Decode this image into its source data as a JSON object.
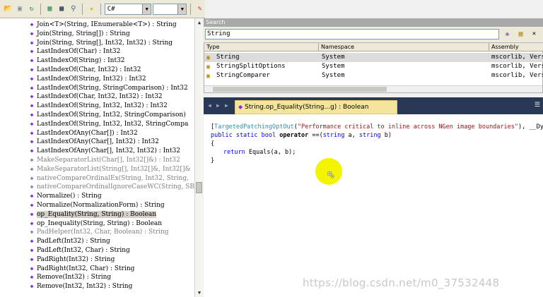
{
  "toolbar": {
    "language_value": "C#",
    "version_value": "",
    "icons": [
      "open-folder-icon",
      "save-icon",
      "refresh-icon",
      "classes-view-icon",
      "console-icon",
      "search-icon",
      "favorite-star-icon",
      "edit-icon"
    ]
  },
  "tree": {
    "items": [
      {
        "label": "Join<T>(String, IEnumerable<T>) : String",
        "gray": false
      },
      {
        "label": "Join(String, String[]) : String",
        "gray": false
      },
      {
        "label": "Join(String, String[], Int32, Int32) : String",
        "gray": false
      },
      {
        "label": "LastIndexOf(Char) : Int32",
        "gray": false
      },
      {
        "label": "LastIndexOf(String) : Int32",
        "gray": false
      },
      {
        "label": "LastIndexOf(Char, Int32) : Int32",
        "gray": false
      },
      {
        "label": "LastIndexOf(String, Int32) : Int32",
        "gray": false
      },
      {
        "label": "LastIndexOf(String, StringComparison) : Int32",
        "gray": false
      },
      {
        "label": "LastIndexOf(Char, Int32, Int32) : Int32",
        "gray": false
      },
      {
        "label": "LastIndexOf(String, Int32, Int32) : Int32",
        "gray": false
      },
      {
        "label": "LastIndexOf(String, Int32, StringComparison)",
        "gray": false
      },
      {
        "label": "LastIndexOf(String, Int32, Int32, StringCompa",
        "gray": false
      },
      {
        "label": "LastIndexOfAny(Char[]) : Int32",
        "gray": false
      },
      {
        "label": "LastIndexOfAny(Char[], Int32) : Int32",
        "gray": false
      },
      {
        "label": "LastIndexOfAny(Char[], Int32, Int32) : Int32",
        "gray": false
      },
      {
        "label": "MakeSeparatorList(Char[], Int32[]&) : Int32",
        "gray": true
      },
      {
        "label": "MakeSeparatorList(String[], Int32[]&, Int32[]&",
        "gray": true
      },
      {
        "label": "nativeCompareOrdinalEx(String, Int32, String,",
        "gray": true
      },
      {
        "label": "nativeCompareOrdinalIgnoreCaseWC(String, SByt",
        "gray": true
      },
      {
        "label": "Normalize() : String",
        "gray": false
      },
      {
        "label": "Normalize(NormalizationForm) : String",
        "gray": false
      },
      {
        "label": "op_Equality(String, String) : Boolean",
        "gray": false,
        "selected": true
      },
      {
        "label": "op_Inequality(String, String) : Boolean",
        "gray": false
      },
      {
        "label": "PadHelper(Int32, Char, Boolean) : String",
        "gray": true
      },
      {
        "label": "PadLeft(Int32) : String",
        "gray": false
      },
      {
        "label": "PadLeft(Int32, Char) : String",
        "gray": false
      },
      {
        "label": "PadRight(Int32) : String",
        "gray": false
      },
      {
        "label": "PadRight(Int32, Char) : String",
        "gray": false
      },
      {
        "label": "Remove(Int32) : String",
        "gray": false
      },
      {
        "label": "Remove(Int32, Int32) : String",
        "gray": false
      }
    ]
  },
  "search": {
    "header": "Search",
    "query": "String",
    "columns": [
      "Type",
      "Namespace",
      "Assembly"
    ],
    "results": [
      {
        "type": "String",
        "namespace": "System",
        "assembly": "mscorlib, Versi",
        "selected": true
      },
      {
        "type": "StringSplitOptions",
        "namespace": "System",
        "assembly": "mscorlib, Versi"
      },
      {
        "type": "StringComparer",
        "namespace": "System",
        "assembly": "mscorlib, Versi"
      }
    ]
  },
  "editor": {
    "tab_title": "String.op_Equality(String...g) : Boolean",
    "code": {
      "line1_bracket_open": "[",
      "line1_attr": "TargetedPatchingOptOut",
      "line1_paren": "(",
      "line1_string": "\"Performance critical to inline across NGen image boundaries\"",
      "line1_rest": "), __Dynamica",
      "line2_kw": "public static bool",
      "line2_op": "operator",
      "line2_rest": "==(",
      "line2_kw2": "string",
      "line2_a": " a, ",
      "line2_kw3": "string",
      "line2_b": " b)",
      "line3": "{",
      "line4_kw": "return",
      "line4_rest": " Equals(a, b);",
      "line5": "}"
    }
  },
  "watermark": "https://blog.csdn.net/m0_37532448"
}
